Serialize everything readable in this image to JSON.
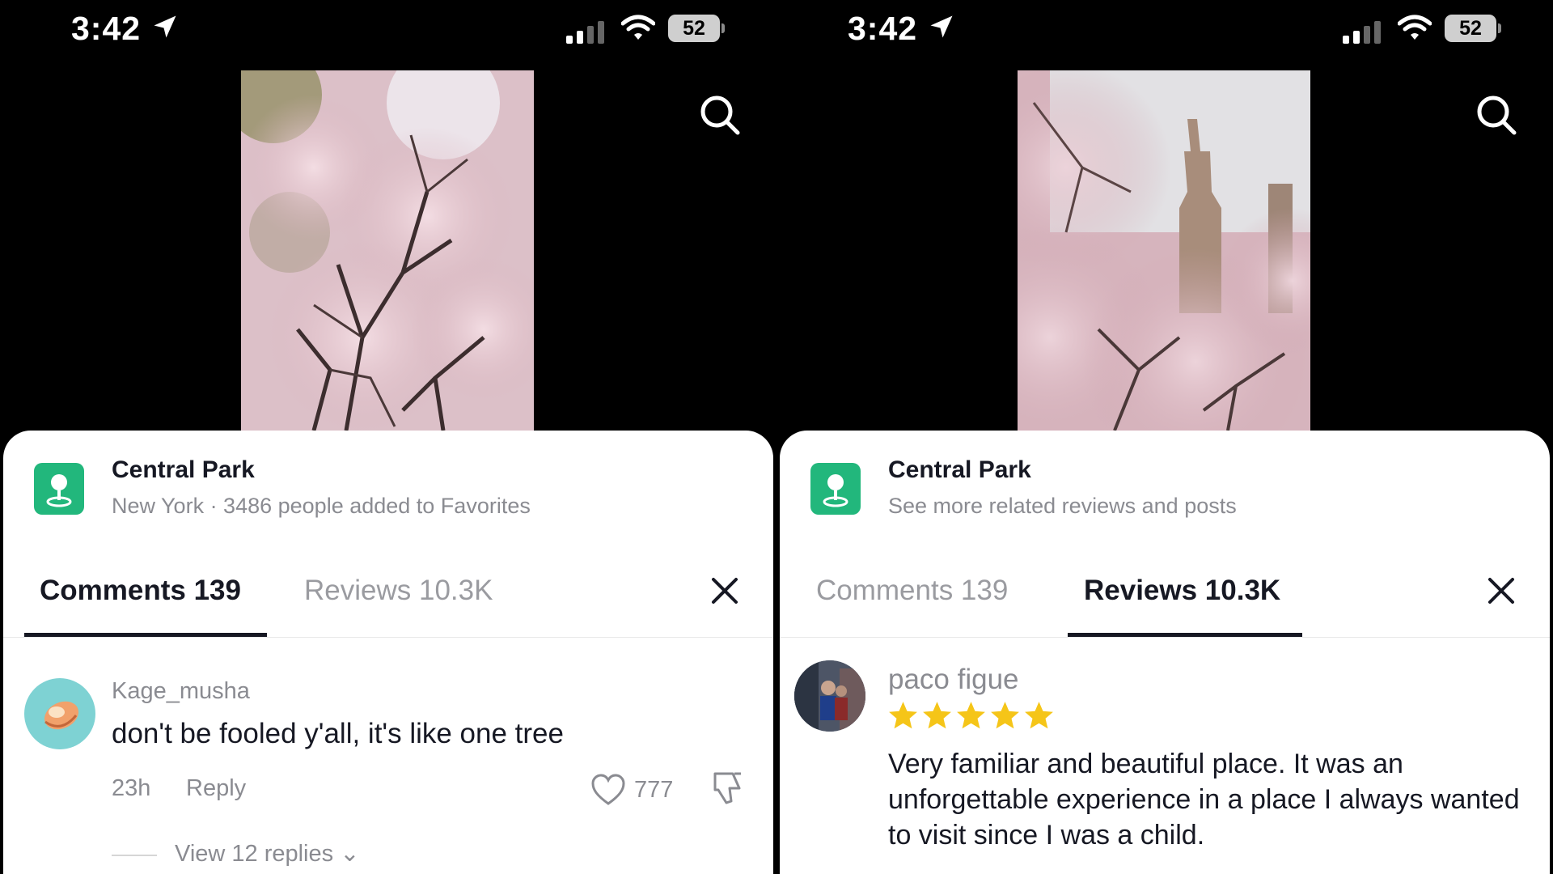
{
  "panels": [
    {
      "status": {
        "time": "3:42",
        "battery": "52"
      },
      "place": {
        "name": "Central Park",
        "subtitle": "New York · 3486 people added to Favorites"
      },
      "tabs": [
        {
          "label": "Comments 139",
          "active": true
        },
        {
          "label": "Reviews 10.3K",
          "active": false
        }
      ],
      "comment": {
        "user": "Kage_musha",
        "text": "don't be fooled y'all, it's like one tree",
        "time": "23h",
        "reply_label": "Reply",
        "likes": "777",
        "view_replies": "View 12 replies"
      }
    },
    {
      "status": {
        "time": "3:42",
        "battery": "52"
      },
      "place": {
        "name": "Central Park",
        "subtitle": "See more related reviews and posts"
      },
      "tabs": [
        {
          "label": "Comments 139",
          "active": false
        },
        {
          "label": "Reviews 10.3K",
          "active": true
        }
      ],
      "review": {
        "user": "paco figue",
        "rating": 5,
        "text": "Very familiar and beautiful place. It was an unforgettable experience in a place I always wanted to visit since I was a child."
      }
    }
  ],
  "colors": {
    "accent_green": "#22b77c",
    "star": "#f5c518",
    "text_primary": "#161823",
    "text_secondary": "#8a8b91"
  },
  "icons": [
    "location-arrow-icon",
    "signal-icon",
    "wifi-icon",
    "battery-icon",
    "search-icon",
    "map-pin-icon",
    "close-icon",
    "heart-icon",
    "dislike-icon",
    "chevron-down-icon",
    "star-icon"
  ]
}
